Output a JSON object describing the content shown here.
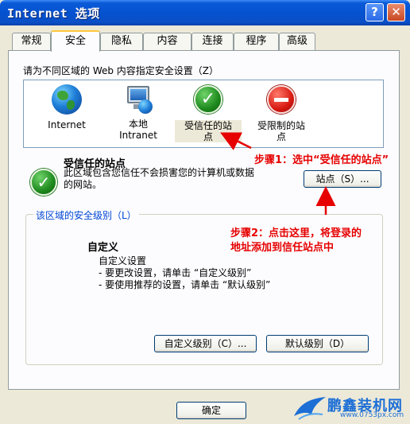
{
  "window": {
    "title": "Internet 选项",
    "help_btn": "?",
    "close_btn": "✕"
  },
  "tabs": [
    "常规",
    "安全",
    "隐私",
    "内容",
    "连接",
    "程序",
    "高级"
  ],
  "active_tab": "安全",
  "zones_prompt": "请为不同区域的 Web 内容指定安全设置（Z）",
  "zones": [
    {
      "icon": "globe-icon",
      "label": "Internet"
    },
    {
      "icon": "local-intranet-icon",
      "label": "本地\nIntranet"
    },
    {
      "icon": "trusted-sites-check-icon",
      "label": "受信任的站\n点"
    },
    {
      "icon": "restricted-sites-icon",
      "label": "受限制的站\n点"
    }
  ],
  "selected_zone": {
    "title": "受信任的站点",
    "description": "此区域包含您信任不会损害您的计算机或数据的网站。",
    "sites_button": "站点（S）..."
  },
  "security_level": {
    "group_label": "该区域的安全级别（L）",
    "level_name": "自定义",
    "lines": [
      "自定义设置",
      "- 要更改设置，请单击 “自定义级别”",
      "- 要使用推荐的设置，请单击 “默认级别”"
    ],
    "custom_button": "自定义级别（C）...",
    "default_button": "默认级别（D）"
  },
  "ok_button": "确定",
  "annotations": {
    "step1": "步骤1：选中“受信任的站点”",
    "step2_line1": "步骤2：点击这里，将登录的",
    "step2_line2": "地址添加到信任站点中"
  },
  "watermark": {
    "text": "鹏鑫装机网",
    "url": "www.0753px.com"
  },
  "colors": {
    "annotation": "#e60000",
    "titlebar": "#0552d0",
    "group_label": "#0046d5",
    "tab_highlight": "#ffc83c"
  }
}
